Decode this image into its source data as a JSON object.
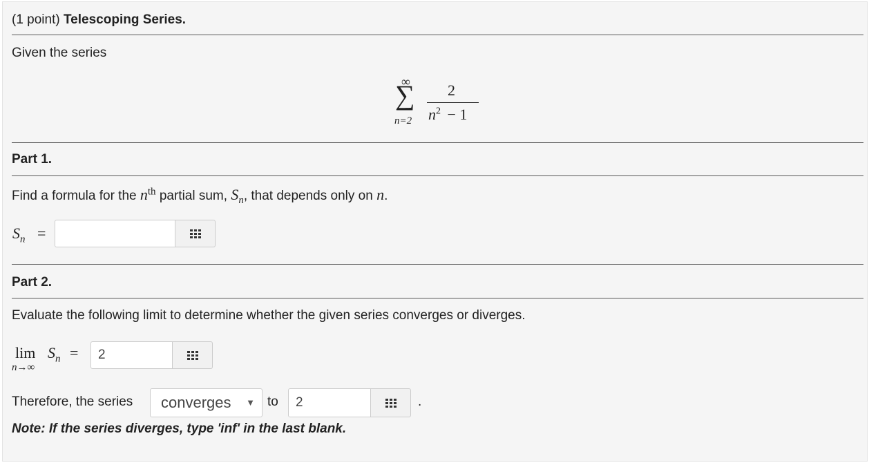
{
  "header": {
    "points": "(1 point)",
    "title": "Telescoping Series."
  },
  "intro": "Given the series",
  "series": {
    "sum_sym": "∑",
    "upper": "∞",
    "lower": "n=2",
    "numerator": "2",
    "denominator_n": "n",
    "denominator_exp": "2",
    "denominator_rest": "− 1"
  },
  "part1": {
    "title": "Part 1.",
    "prompt_pre": "Find a formula for the ",
    "prompt_n": "n",
    "prompt_th": "th",
    "prompt_mid": " partial sum, ",
    "prompt_S": "S",
    "prompt_sub": "n",
    "prompt_post": ", that depends only on ",
    "prompt_end_n": "n",
    "prompt_period": ".",
    "lhs_S": "S",
    "lhs_sub": "n",
    "eq": "=",
    "answer": ""
  },
  "part2": {
    "title": "Part 2.",
    "prompt": "Evaluate the following limit to determine whether the given series converges or diverges.",
    "lim": "lim",
    "lim_sub": "n→∞",
    "lhs_S": "S",
    "lhs_sub": "n",
    "eq": "=",
    "limit_answer": "2",
    "therefore_text": "Therefore, the series",
    "select_value": "converges",
    "select_caret": "▼",
    "to_text": "to",
    "value_answer": "2",
    "period": ".",
    "note": "Note: If the series diverges, type 'inf' in the last blank."
  },
  "icons": {
    "palette": "grid-icon",
    "dropdown": "triangle-down-icon"
  }
}
